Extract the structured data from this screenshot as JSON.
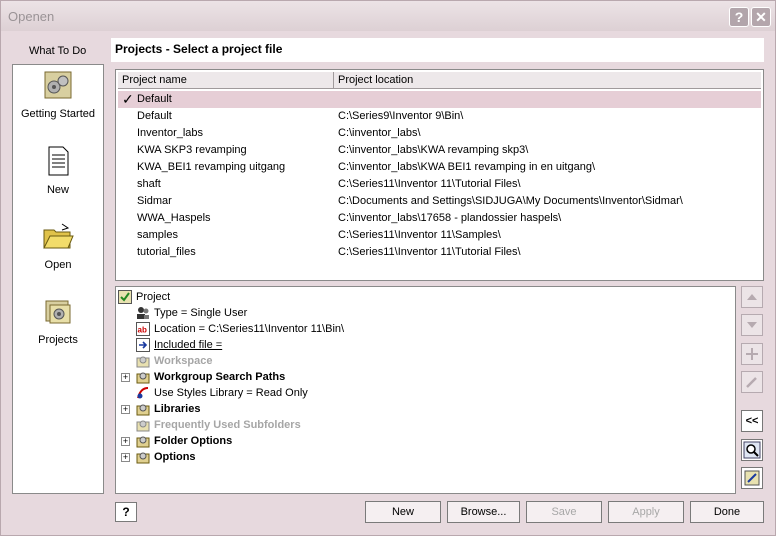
{
  "window": {
    "title": "Openen"
  },
  "sidebar": {
    "header": "What To Do",
    "items": [
      {
        "label": "Getting Started",
        "icon": "getting-started-icon"
      },
      {
        "label": "New",
        "icon": "new-document-icon"
      },
      {
        "label": "Open",
        "icon": "open-folder-icon"
      },
      {
        "label": "Projects",
        "icon": "projects-icon"
      }
    ]
  },
  "heading": "Projects - Select a project file",
  "project_list": {
    "columns": [
      "Project name",
      "Project location"
    ],
    "rows": [
      {
        "name": "Default",
        "location": "",
        "active": true
      },
      {
        "name": "Default",
        "location": "C:\\Series9\\Inventor 9\\Bin\\"
      },
      {
        "name": "Inventor_labs",
        "location": "C:\\inventor_labs\\"
      },
      {
        "name": "KWA SKP3 revamping",
        "location": "C:\\inventor_labs\\KWA revamping skp3\\"
      },
      {
        "name": "KWA_BEI1 revamping uitgang",
        "location": "C:\\inventor_labs\\KWA BEI1 revamping in en uitgang\\"
      },
      {
        "name": "shaft",
        "location": "C:\\Series11\\Inventor 11\\Tutorial Files\\"
      },
      {
        "name": "Sidmar",
        "location": "C:\\Documents and Settings\\SIDJUGA\\My Documents\\Inventor\\Sidmar\\"
      },
      {
        "name": "WWA_Haspels",
        "location": "C:\\inventor_labs\\17658 - plandossier haspels\\"
      },
      {
        "name": "samples",
        "location": "C:\\Series11\\Inventor 11\\Samples\\"
      },
      {
        "name": "tutorial_files",
        "location": "C:\\Series11\\Inventor 11\\Tutorial Files\\"
      }
    ]
  },
  "tree": {
    "root": "Project",
    "type": "Type = Single User",
    "location": "Location = C:\\Series11\\Inventor 11\\Bin\\",
    "included": "Included file = ",
    "workspace": "Workspace",
    "workgroup": "Workgroup Search Paths",
    "styles": "Use Styles Library = Read Only",
    "libraries": "Libraries",
    "frequent": "Frequently Used Subfolders",
    "folder_options": "Folder Options",
    "options": "Options"
  },
  "side_buttons": {
    "collapse_label": "<<"
  },
  "buttons": {
    "help": "?",
    "new": "New",
    "browse": "Browse...",
    "save": "Save",
    "apply": "Apply",
    "done": "Done"
  },
  "colors": {
    "background": "#e7d9de",
    "active_row": "#e6ced6",
    "disabled_text": "#a7a7a7"
  }
}
